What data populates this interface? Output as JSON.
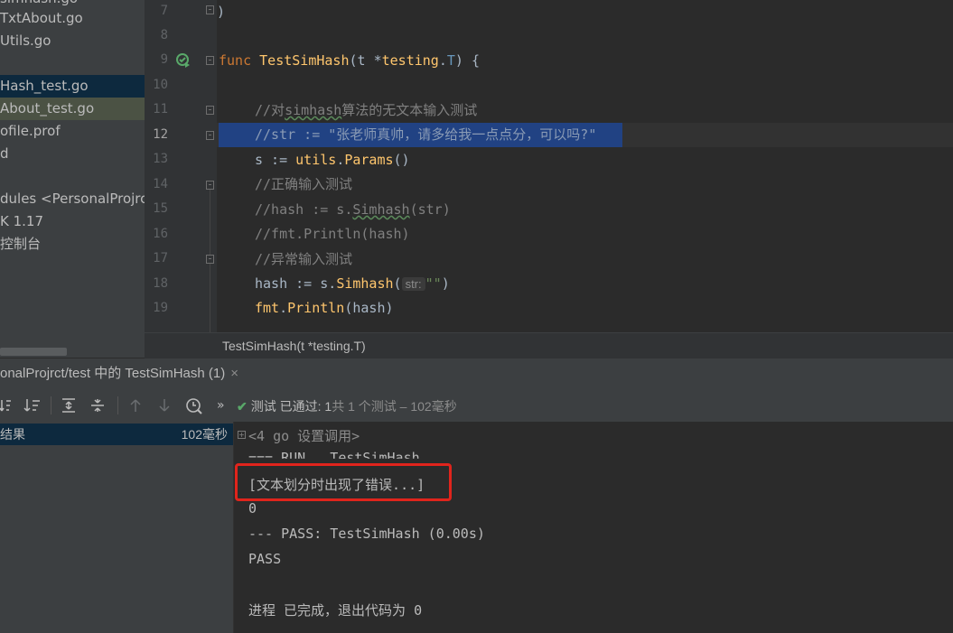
{
  "project_tree": {
    "items": [
      {
        "label": "simhash.go",
        "state": "partial"
      },
      {
        "label": "TxtAbout.go"
      },
      {
        "label": "Utils.go"
      },
      {
        "label": ""
      },
      {
        "label": "Hash_test.go",
        "state": "selected"
      },
      {
        "label": "About_test.go",
        "state": "highlighted"
      },
      {
        "label": "ofile.prof"
      },
      {
        "label": "d"
      },
      {
        "label": ""
      },
      {
        "label": "dules <PersonalProjrct"
      },
      {
        "label": "K 1.17"
      },
      {
        "label": "控制台"
      }
    ]
  },
  "editor": {
    "line_numbers": [
      "7",
      "8",
      "9",
      "10",
      "11",
      "12",
      "13",
      "14",
      "15",
      "16",
      "17",
      "18",
      "19"
    ],
    "lines": {
      "l7": ")",
      "l9_kw": "func",
      "l9_fn": "TestSimHash",
      "l9_p1": "(t *",
      "l9_pkg": "testing",
      "l9_dot": ".",
      "l9_type": "T",
      "l9_end": ") {",
      "l11_a": "//对",
      "l11_b": "simhash",
      "l11_c": "算法的无文本输入测试",
      "l12": "//str := \"张老师真帅，请多给我一点点分，可以吗?\"",
      "l13_a": "s := ",
      "l13_pkg": "utils",
      "l13_dot": ".",
      "l13_fn": "Params",
      "l13_end": "()",
      "l14": "//正确输入测试",
      "l15_a": "//hash := s.",
      "l15_b": "Simhash",
      "l15_c": "(str)",
      "l16": "//fmt.Println(hash)",
      "l17": "//异常输入测试",
      "l18_a": "hash := s.",
      "l18_fn": "Simhash",
      "l18_p": "(",
      "l18_hint": "str:",
      "l18_str": "\"\"",
      "l18_end": ")",
      "l19_pkg": "fmt",
      "l19_dot": ".",
      "l19_fn": "Println",
      "l19_end": "(hash)"
    },
    "current_line": "12"
  },
  "breadcrumb": {
    "label": "TestSimHash(t *testing.T)"
  },
  "run_panel": {
    "tab_label": "onalProjrct/test 中的 TestSimHash (1)",
    "tab_close": "×",
    "status_check": "✔",
    "status_main": "测试 已通过: 1",
    "status_detail": "共 1 个测试 – 102毫秒",
    "more": "»",
    "test_result_label": "结果",
    "test_result_time": "102毫秒"
  },
  "console": {
    "lines": [
      "<4 go 设置调用>",
      "=== RUN   TestSimHash",
      "[文本划分时出现了错误...]",
      "0",
      "--- PASS: TestSimHash (0.00s)",
      "PASS",
      "",
      "进程 已完成，退出代码为 0"
    ]
  },
  "colors": {
    "selection": "#214283",
    "keyword": "#cc7832",
    "function": "#ffc66d",
    "comment": "#808080",
    "pass_green": "#59a869",
    "highlight_box": "#e0241c"
  }
}
